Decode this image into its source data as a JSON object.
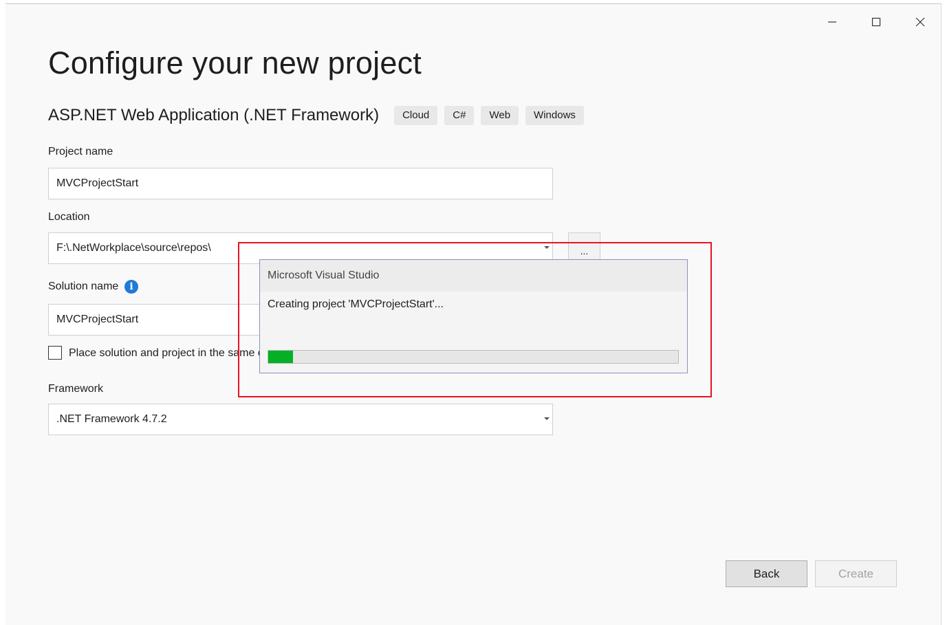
{
  "window": {
    "controls": [
      {
        "name": "minimize-button",
        "glyph": "—"
      },
      {
        "name": "maximize-button",
        "glyph": "☐"
      },
      {
        "name": "close-button",
        "glyph": "✕"
      }
    ]
  },
  "page": {
    "title": "Configure your new project",
    "template_name": "ASP.NET Web Application (.NET Framework)",
    "tags": [
      "Cloud",
      "C#",
      "Web",
      "Windows"
    ]
  },
  "form": {
    "project_name": {
      "label": "Project name",
      "value": "MVCProjectStart"
    },
    "location": {
      "label": "Location",
      "value": "F:\\.NetWorkplace\\source\\repos\\",
      "browse_label": "..."
    },
    "solution_name": {
      "label": "Solution name",
      "value": "MVCProjectStart",
      "info_icon": "info-icon",
      "info_glyph": "i"
    },
    "same_directory": {
      "label": "Place solution and project in the same directory",
      "checked": false
    },
    "framework": {
      "label": "Framework",
      "value": ".NET Framework 4.7.2"
    }
  },
  "buttons": {
    "back": "Back",
    "create": "Create"
  },
  "progress_dialog": {
    "title": "Microsoft Visual Studio",
    "message": "Creating project 'MVCProjectStart'...",
    "progress_percent": 6,
    "progress_color": "#06b025"
  },
  "highlight": {
    "color": "#e81123"
  }
}
